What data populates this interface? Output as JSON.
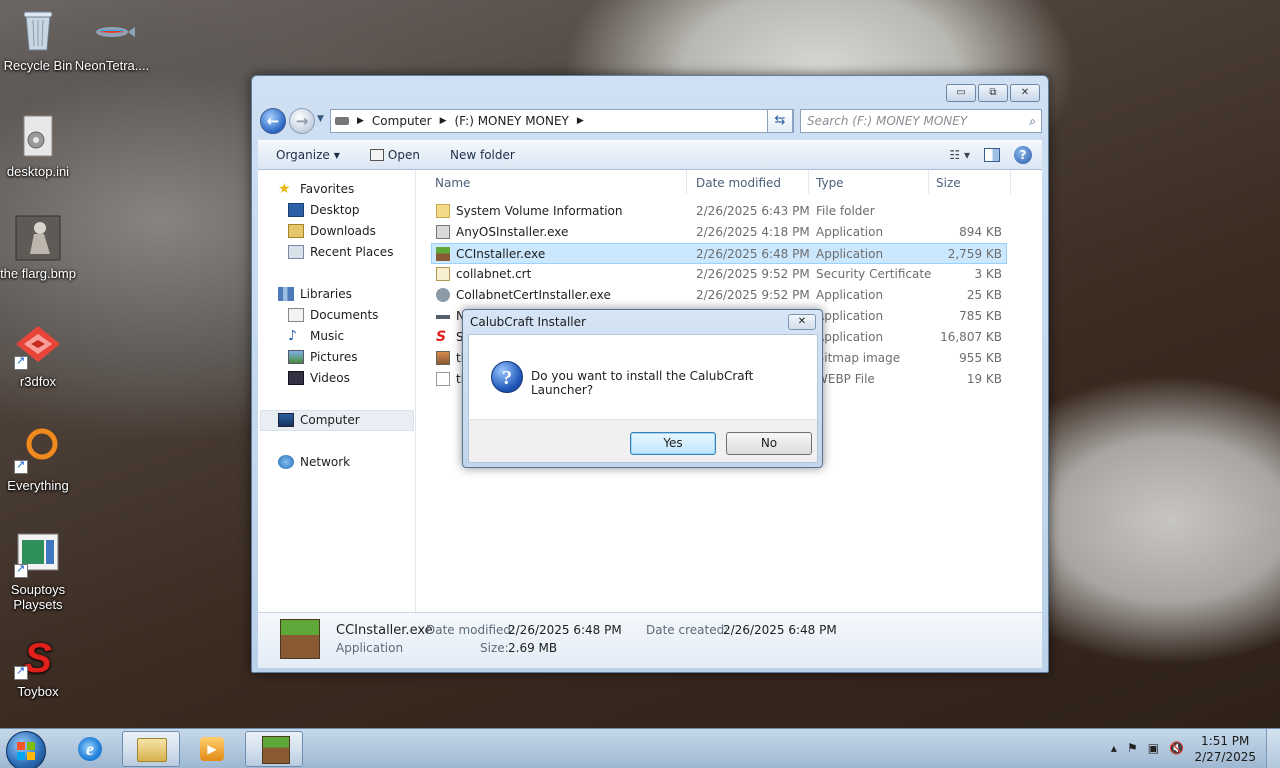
{
  "desktop": {
    "icons": [
      {
        "label": "Recycle Bin"
      },
      {
        "label": "NeonTetra...."
      },
      {
        "label": "desktop.ini"
      },
      {
        "label": "the flarg.bmp"
      },
      {
        "label": "r3dfox"
      },
      {
        "label": "Everything"
      },
      {
        "label": "Souptoys Playsets"
      },
      {
        "label": "Toybox"
      }
    ]
  },
  "explorer": {
    "window_buttons": {
      "minimize": "▭",
      "maximize": "⧉",
      "close": "✕"
    },
    "address": {
      "computer": "Computer",
      "drive": "(F:) MONEY MONEY"
    },
    "search_placeholder": "Search (F:) MONEY MONEY",
    "toolbar": {
      "organize": "Organize",
      "open": "Open",
      "new_folder": "New folder"
    },
    "nav": {
      "favorites": "Favorites",
      "desktop": "Desktop",
      "downloads": "Downloads",
      "recent_places": "Recent Places",
      "libraries": "Libraries",
      "documents": "Documents",
      "music": "Music",
      "pictures": "Pictures",
      "videos": "Videos",
      "computer": "Computer",
      "network": "Network"
    },
    "columns": {
      "name": "Name",
      "date": "Date modified",
      "type": "Type",
      "size": "Size"
    },
    "files": [
      {
        "name": "System Volume Information",
        "date": "2/26/2025 6:43 PM",
        "type": "File folder",
        "size": ""
      },
      {
        "name": "AnyOSInstaller.exe",
        "date": "2/26/2025 4:18 PM",
        "type": "Application",
        "size": "894 KB"
      },
      {
        "name": "CCInstaller.exe",
        "date": "2/26/2025 6:48 PM",
        "type": "Application",
        "size": "2,759 KB"
      },
      {
        "name": "collabnet.crt",
        "date": "2/26/2025 9:52 PM",
        "type": "Security Certificate",
        "size": "3 KB"
      },
      {
        "name": "CollabnetCertInstaller.exe",
        "date": "2/26/2025 9:52 PM",
        "type": "Application",
        "size": "25 KB"
      },
      {
        "name": "N",
        "date": "",
        "type": "Application",
        "size": "785 KB"
      },
      {
        "name": "S",
        "date": "",
        "type": "Application",
        "size": "16,807 KB"
      },
      {
        "name": "th",
        "date": "",
        "type": "Bitmap image",
        "size": "955 KB"
      },
      {
        "name": "th",
        "date": "",
        "type": "WEBP File",
        "size": "19 KB"
      }
    ],
    "details": {
      "filename": "CCInstaller.exe",
      "kind": "Application",
      "modified_label": "Date modified:",
      "modified_value": "2/26/2025 6:48 PM",
      "created_label": "Date created:",
      "created_value": "2/26/2025 6:48 PM",
      "size_label": "Size:",
      "size_value": "2.69 MB"
    }
  },
  "dialog": {
    "title": "CalubCraft Installer",
    "message": "Do you want to install the CalubCraft Launcher?",
    "yes": "Yes",
    "no": "No",
    "close": "✕"
  },
  "taskbar": {
    "time": "1:51 PM",
    "date": "2/27/2025"
  }
}
